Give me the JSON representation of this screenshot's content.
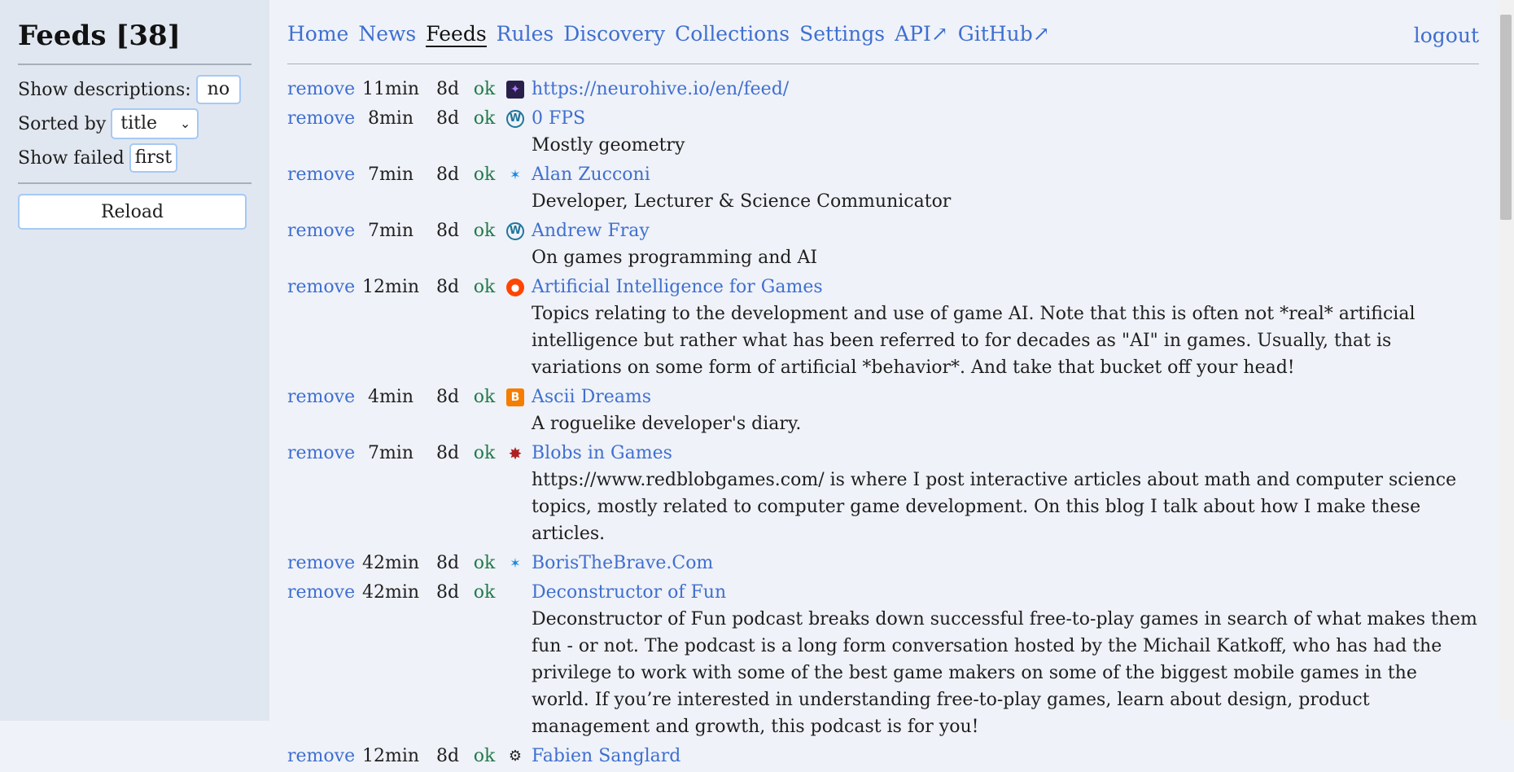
{
  "sidebar": {
    "title": "Feeds [38]",
    "show_descriptions_label": "Show descriptions:",
    "show_descriptions_value": "no",
    "sorted_by_label": "Sorted by",
    "sorted_by_value": "title",
    "show_failed_label": "Show failed",
    "show_failed_value": "first",
    "reload_label": "Reload"
  },
  "nav": {
    "items": [
      {
        "label": "Home"
      },
      {
        "label": "News"
      },
      {
        "label": "Feeds"
      },
      {
        "label": "Rules"
      },
      {
        "label": "Discovery"
      },
      {
        "label": "Collections"
      },
      {
        "label": "Settings"
      },
      {
        "label": "API↗"
      },
      {
        "label": "GitHub↗"
      }
    ],
    "active": "Feeds",
    "logout_label": "logout"
  },
  "feeds": [
    {
      "remove": "remove",
      "age": "11min",
      "days": "8d",
      "status": "ok",
      "icon": "neurohive-icon",
      "title": "https://neurohive.io/en/feed/",
      "description": ""
    },
    {
      "remove": "remove",
      "age": "8min",
      "days": "8d",
      "status": "ok",
      "icon": "wordpress-icon",
      "title": "0 FPS",
      "description": "Mostly geometry"
    },
    {
      "remove": "remove",
      "age": "7min",
      "days": "8d",
      "status": "ok",
      "icon": "star-icon",
      "title": "Alan Zucconi",
      "description": "Developer, Lecturer & Science Communicator"
    },
    {
      "remove": "remove",
      "age": "7min",
      "days": "8d",
      "status": "ok",
      "icon": "wordpress-icon",
      "title": "Andrew Fray",
      "description": "On games programming and AI"
    },
    {
      "remove": "remove",
      "age": "12min",
      "days": "8d",
      "status": "ok",
      "icon": "reddit-icon",
      "title": "Artificial Intelligence for Games",
      "description": "Topics relating to the development and use of game AI. Note that this is often not *real* artificial intelligence but rather what has been referred to for decades as \"AI\" in games. Usually, that is variations on some form of artificial *behavior*. And take that bucket off your head!"
    },
    {
      "remove": "remove",
      "age": "4min",
      "days": "8d",
      "status": "ok",
      "icon": "blogger-icon",
      "title": "Ascii Dreams",
      "description": "A roguelike developer's diary."
    },
    {
      "remove": "remove",
      "age": "7min",
      "days": "8d",
      "status": "ok",
      "icon": "blob-icon",
      "title": "Blobs in Games",
      "description": "https://www.redblobgames.com/ is where I post interactive articles about math and computer science topics, mostly related to computer game development. On this blog I talk about how I make these articles."
    },
    {
      "remove": "remove",
      "age": "42min",
      "days": "8d",
      "status": "ok",
      "icon": "star-icon",
      "title": "BorisTheBrave.Com",
      "description": ""
    },
    {
      "remove": "remove",
      "age": "42min",
      "days": "8d",
      "status": "ok",
      "icon": "",
      "title": "Deconstructor of Fun",
      "description": "Deconstructor of Fun podcast breaks down successful free-to-play games in search of what makes them fun - or not. The podcast is a long form conversation hosted by the Michail Katkoff, who has had the privilege to work with some of the best game makers on some of the biggest mobile games in the world. If you’re interested in understanding free-to-play games, learn about design, product management and growth, this podcast is for you!"
    },
    {
      "remove": "remove",
      "age": "12min",
      "days": "8d",
      "status": "ok",
      "icon": "gear-icon",
      "title": "Fabien Sanglard",
      "description": ""
    }
  ]
}
